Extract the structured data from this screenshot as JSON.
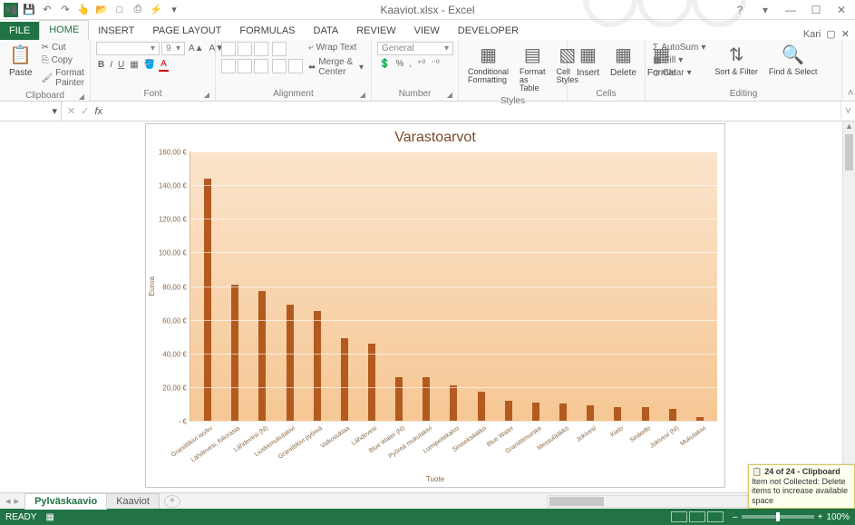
{
  "app": {
    "title": "Kaaviot.xlsx - Excel",
    "user": "Kari"
  },
  "qat": {
    "save": "💾",
    "undo": "↶",
    "redo": "↷",
    "touch": "👆",
    "open": "📂",
    "new": "□",
    "print": "⎙",
    "quick": "⚡",
    "more": "▾"
  },
  "tabs": {
    "file": "FILE",
    "home": "HOME",
    "insert": "INSERT",
    "pagelayout": "PAGE LAYOUT",
    "formulas": "FORMULAS",
    "data": "DATA",
    "review": "REVIEW",
    "view": "VIEW",
    "developer": "DEVELOPER"
  },
  "win": {
    "help": "?",
    "opts": "▾",
    "min": "—",
    "max": "☐",
    "close": "✕",
    "ribmin": "▢",
    "rclose": "✕"
  },
  "ribbon": {
    "clipboard": {
      "label": "Clipboard",
      "paste": "Paste",
      "cut": "Cut",
      "copy": "Copy",
      "painter": "Format Painter",
      "paste_ic": "📋",
      "cut_ic": "✂",
      "copy_ic": "⎘",
      "brush_ic": "🖌"
    },
    "font": {
      "label": "Font",
      "name": "",
      "size": "9",
      "grow": "A▲",
      "shrink": "A▼",
      "bold": "B",
      "italic": "I",
      "under": "U",
      "border": "▦",
      "fill": "🪣",
      "color": "A"
    },
    "alignment": {
      "label": "Alignment",
      "wrap": "Wrap Text",
      "merge": "Merge & Center",
      "wrap_ic": "⤶",
      "merge_ic": "⬌"
    },
    "number": {
      "label": "Number",
      "format": "General",
      "cur": "💲",
      "pct": "%",
      "comma": ",",
      "inc": "⁺⁰",
      "dec": "⁻⁰"
    },
    "styles": {
      "label": "Styles",
      "cond": "Conditional Formatting",
      "table": "Format as Table",
      "cell": "Cell Styles"
    },
    "cells": {
      "label": "Cells",
      "insert": "Insert",
      "delete": "Delete",
      "format": "Format"
    },
    "editing": {
      "label": "Editing",
      "autosum": "AutoSum",
      "fill": "Fill",
      "clear": "Clear",
      "sort": "Sort & Filter",
      "find": "Find & Select",
      "sum_ic": "Σ",
      "fill_ic": "▦",
      "clear_ic": "◇"
    }
  },
  "fbar": {
    "name": "",
    "cancel": "✕",
    "enter": "✓",
    "fx": "fx"
  },
  "chart_data": {
    "type": "bar",
    "title": "Varastoarvot",
    "xlabel": "Tuote",
    "ylabel": "Euroa",
    "ylim": [
      0,
      160
    ],
    "ystep": 20,
    "yticks": [
      "- €",
      "20,00 €",
      "40,00 €",
      "60,00 €",
      "80,00 €",
      "100,00 €",
      "120,00 €",
      "140,00 €",
      "160,00 €"
    ],
    "categories": [
      "Graniittikivi iso/kv",
      "Lähdevesi, foliorasia",
      "Lähdevesi (hl)",
      "Liuskemukulakivi",
      "Graniittikivi pyöreä",
      "Valkosuklaa",
      "Lähdevesi",
      "Blue Water (hl)",
      "Pyöreä mukulakivi",
      "Lumipeitekalvo",
      "Siniseksilakko",
      "Blue Water",
      "Graniittimurske",
      "Messulääkko",
      "Jokivesi",
      "Kielo",
      "Sinikello",
      "Jokivesi (hl)",
      "Mukulakivi"
    ],
    "values": [
      144,
      81,
      77,
      69,
      65,
      49,
      46,
      26,
      26,
      21,
      17,
      12,
      11,
      10,
      9,
      8,
      8,
      7,
      2
    ]
  },
  "sheets": {
    "active": "Pylväskaavio",
    "other": "Kaaviot",
    "add": "+",
    "nav_l": "◂",
    "nav_r": "▸"
  },
  "clip": {
    "head": "24 of 24 - Clipboard",
    "body": "Item not Collected: Delete items to increase available space",
    "ic": "📋"
  },
  "status": {
    "ready": "READY",
    "rec": "▦",
    "zoom": "100%",
    "minus": "–",
    "plus": "+"
  }
}
